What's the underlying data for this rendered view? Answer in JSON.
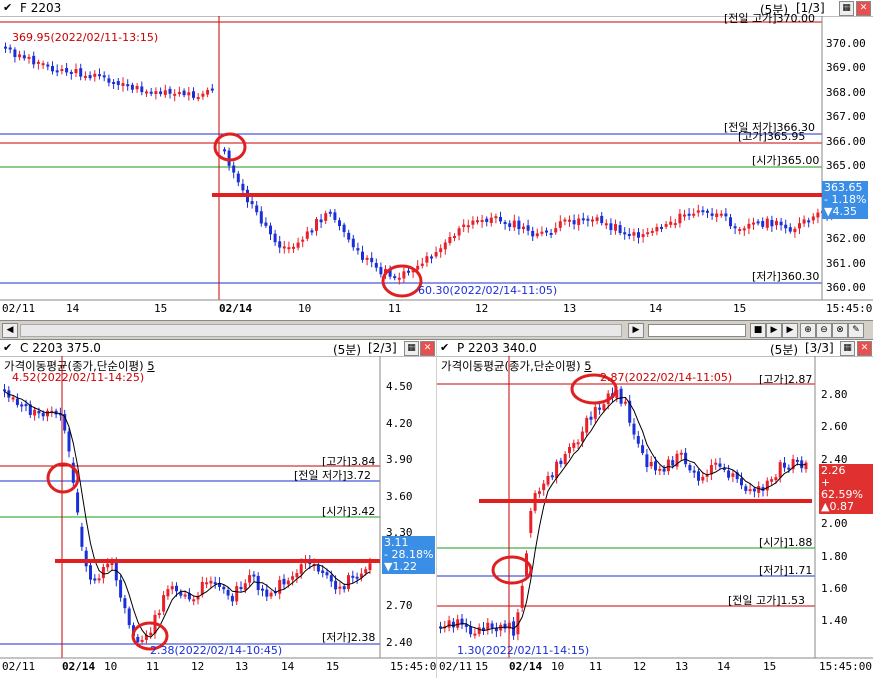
{
  "panes": {
    "futures": {
      "title": "F 2203",
      "period": "(5분)",
      "page": "[1/3]",
      "high_label": "369.95(2022/02/11-13:15)",
      "low_label": "60.30(2022/02/14-11:05)",
      "yticks": [
        "370.00",
        "369.00",
        "368.00",
        "367.00",
        "366.00",
        "365.00",
        "364.00",
        "363.00",
        "362.00",
        "361.00",
        "360.00"
      ],
      "ref_labels": {
        "prev_low": "[전일 저가]366.30",
        "high": "[고가]365.95",
        "open": "[시가]365.00",
        "low": "[저가]360.30",
        "top_cut": "[전일 고가]370.00"
      },
      "current": {
        "price": "363.65",
        "pct": "- 1.18%",
        "chg": "▼4.35"
      },
      "xticks": [
        "02/11",
        "14",
        "15",
        "02/14",
        "10",
        "11",
        "12",
        "13",
        "14",
        "15",
        "15:45:00"
      ]
    },
    "call": {
      "title": "C 2203 375.0",
      "period": "(5분)",
      "page": "[2/3]",
      "indicator": "가격이동평균(종가,단순이평)",
      "indicator_n": "5",
      "high_label": "4.52(2022/02/11-14:25)",
      "low_label": "2.38(2022/02/14-10:45)",
      "yticks": [
        "4.50",
        "4.20",
        "3.90",
        "3.60",
        "3.30",
        "3.00",
        "2.70",
        "2.40"
      ],
      "ref_labels": {
        "high": "[고가]3.84",
        "prev_low": "[전일 저가]3.72",
        "open": "[시가]3.42",
        "low": "[저가]2.38"
      },
      "current": {
        "price": "3.11",
        "pct": "- 28.18%",
        "chg": "▼1.22"
      },
      "xticks": [
        "02/11",
        "02/14",
        "10",
        "11",
        "12",
        "13",
        "14",
        "15",
        "15:45:00"
      ]
    },
    "put": {
      "title": "P 2203 340.0",
      "period": "(5분)",
      "page": "[3/3]",
      "indicator": "가격이동평균(종가,단순이평)",
      "indicator_n": "5",
      "high_label": "2.87(2022/02/14-11:05)",
      "low_label": "1.30(2022/02/11-14:15)",
      "yticks": [
        "2.80",
        "2.60",
        "2.40",
        "2.20",
        "2.00",
        "1.80",
        "1.60",
        "1.40"
      ],
      "ref_labels": {
        "high": "[고가]2.87",
        "open": "[시가]1.88",
        "low": "[저가]1.71",
        "prev_high": "[전일 고가]1.53"
      },
      "current": {
        "price": "2.26",
        "pct": "+ 62.59%",
        "chg": "▲0.87"
      },
      "xticks": [
        "02/11",
        "15",
        "02/14",
        "10",
        "11",
        "12",
        "13",
        "14",
        "15",
        "15:45:00"
      ]
    }
  },
  "colors": {
    "up": "#e8202a",
    "down": "#1a2fd6",
    "highlight": "#e02020",
    "ma": "#000000"
  }
}
